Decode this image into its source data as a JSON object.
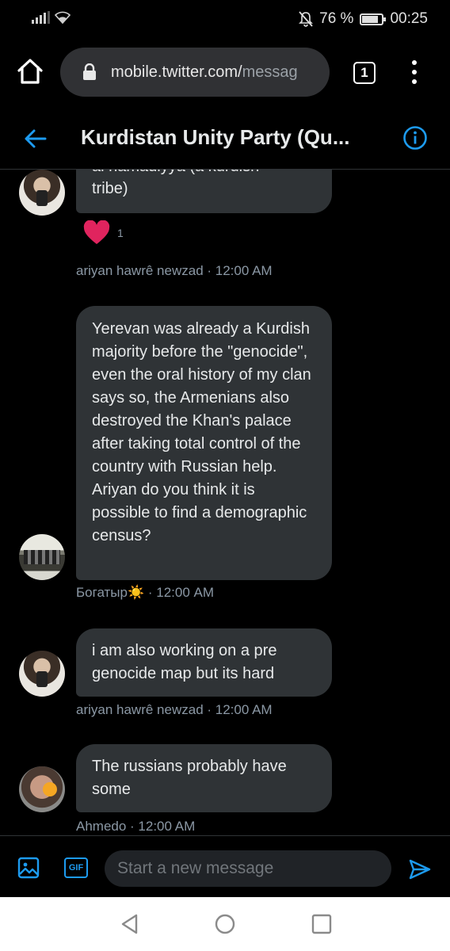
{
  "status_bar": {
    "battery_percent": "76 %",
    "battery_level": 0.76,
    "time": "00:25",
    "icons": [
      "signal-icon",
      "wifi-icon",
      "mute-icon",
      "battery-icon"
    ]
  },
  "browser": {
    "url_main": "mobile.twitter.com/",
    "url_faded": "messag",
    "tab_count": "1"
  },
  "header": {
    "title": "Kurdistan Unity Party (Qu..."
  },
  "messages": [
    {
      "text_top": "al hamadiyya (a kurdish",
      "text": "tribe)",
      "reaction_count": "1",
      "author_line": "ariyan hawrê newzad · 12:00 AM"
    },
    {
      "text": "Yerevan was already a Kurdish majority before the \"genocide\", even the oral history of my clan says so, the Armenians also destroyed the Khan's palace after taking total control of the country with Russian help.  Ariyan do you think it is possible to find a demographic census?",
      "author_name": "Богатыр",
      "author_emoji": "☀️",
      "time": " · 12:00 AM"
    },
    {
      "text": "i am also working on a pre genocide map but its hard",
      "author_line": "ariyan hawrê newzad · 12:00 AM"
    },
    {
      "text": "The russians probably have some",
      "author_line": "Ahmedo · 12:00 AM"
    }
  ],
  "composer": {
    "gif_label": "GIF",
    "placeholder": "Start a new message"
  },
  "colors": {
    "accent": "#1d9bf0",
    "bubble": "#2f3336",
    "background": "#000000",
    "heart": "#f91880"
  }
}
